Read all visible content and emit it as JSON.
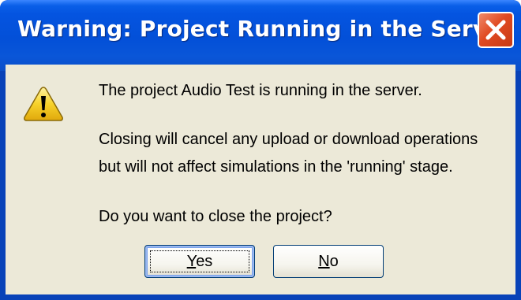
{
  "dialog": {
    "title": "Warning: Project Running in the Server",
    "icon": "warning-icon",
    "messages": {
      "line1": "The project Audio Test is running in the server.",
      "line2": "Closing  will cancel any upload or download operations",
      "line3": "but will not affect simulations in the 'running' stage.",
      "line4": "Do you want to close the project?"
    },
    "buttons": {
      "yes": {
        "accel": "Y",
        "rest": "es"
      },
      "no": {
        "accel": "N",
        "rest": "o"
      }
    }
  },
  "colors": {
    "titlebar": "#0454e0",
    "client": "#ece9d8",
    "close_button": "#e04a22",
    "warning_yellow": "#f7d22a"
  }
}
